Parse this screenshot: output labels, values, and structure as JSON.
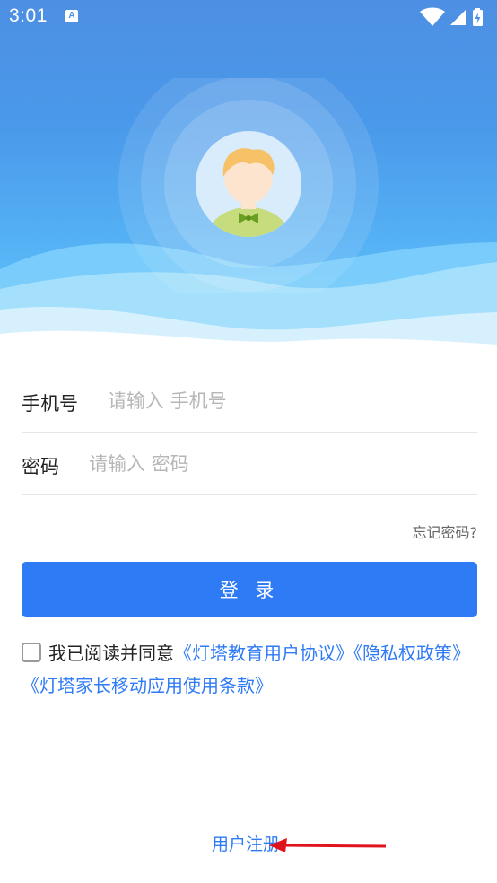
{
  "status_bar": {
    "time": "3:01",
    "app_icon_letter": "A",
    "icons": [
      "wifi-icon",
      "signal-icon",
      "battery-charging-icon"
    ]
  },
  "header": {
    "avatar": "child-avatar-icon"
  },
  "form": {
    "phone_label": "手机号",
    "phone_placeholder": "请输入 手机号",
    "password_label": "密码",
    "password_placeholder": "请输入 密码",
    "forgot_password": "忘记密码?"
  },
  "login_button": "登 录",
  "agreement": {
    "prefix": "我已阅读并同意",
    "user_agreement": "《灯塔教育用户协议》",
    "privacy_policy": "《隐私权政策》",
    "parent_terms": "《灯塔家长移动应用使用条款》"
  },
  "register_link": "用户注册",
  "colors": {
    "primary": "#2f7bf6",
    "header_blue": "#4d8fe3",
    "annotation_red": "#e0141e"
  }
}
